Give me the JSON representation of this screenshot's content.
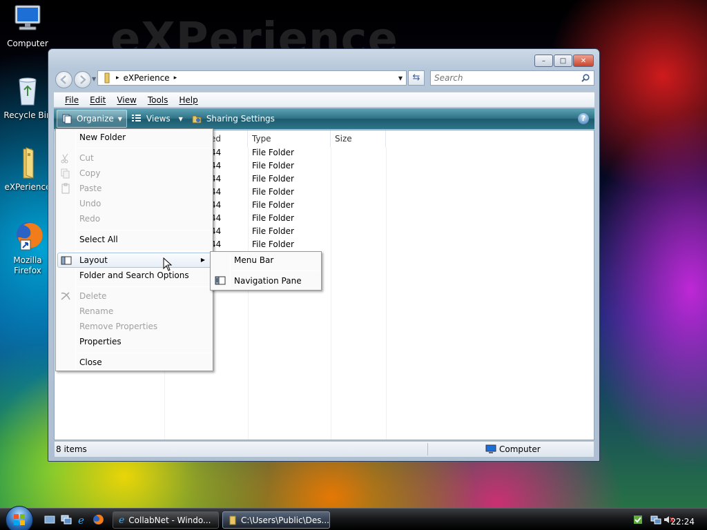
{
  "wallpaper_text": "eXPerience",
  "desktop": {
    "icons": [
      {
        "label": "Computer"
      },
      {
        "label": "Recycle Bin"
      },
      {
        "label": "eXPerience"
      },
      {
        "label": "Mozilla Firefox"
      }
    ]
  },
  "window": {
    "controls": {
      "minimize": "–",
      "maximize": "□",
      "close": "✕"
    },
    "breadcrumb": {
      "separator": "▸",
      "folder": "eXPerience"
    },
    "search_placeholder": "Search",
    "menu": [
      "File",
      "Edit",
      "View",
      "Tools",
      "Help"
    ],
    "toolbar": {
      "organize": "Organize",
      "views": "Views",
      "sharing": "Sharing Settings",
      "help": "?"
    },
    "columns": {
      "modified_partial": "ed",
      "type": "Type",
      "size": "Size"
    },
    "rows": [
      {
        "modified_partial": "44",
        "type": "File Folder"
      },
      {
        "modified_partial": "44",
        "type": "File Folder"
      },
      {
        "modified_partial": "44",
        "type": "File Folder"
      },
      {
        "modified_partial": "44",
        "type": "File Folder"
      },
      {
        "modified_partial": "44",
        "type": "File Folder"
      },
      {
        "modified_partial": "44",
        "type": "File Folder"
      },
      {
        "modified_partial": "44",
        "type": "File Folder"
      },
      {
        "modified_partial": "44",
        "type": "File Folder"
      }
    ],
    "status": {
      "count": "8 items",
      "location": "Computer"
    }
  },
  "organize_menu": {
    "new_folder": "New Folder",
    "cut": "Cut",
    "copy": "Copy",
    "paste": "Paste",
    "undo": "Undo",
    "redo": "Redo",
    "select_all": "Select All",
    "layout": "Layout",
    "folder_options": "Folder and Search Options",
    "delete": "Delete",
    "rename": "Rename",
    "remove_properties": "Remove Properties",
    "properties": "Properties",
    "close": "Close"
  },
  "layout_submenu": {
    "menu_bar": "Menu Bar",
    "navigation_pane": "Navigation Pane"
  },
  "taskbar": {
    "tasks": [
      {
        "label": "CollabNet - Windo..."
      },
      {
        "label": "C:\\Users\\Public\\Des..."
      }
    ],
    "clock": "22:24"
  }
}
